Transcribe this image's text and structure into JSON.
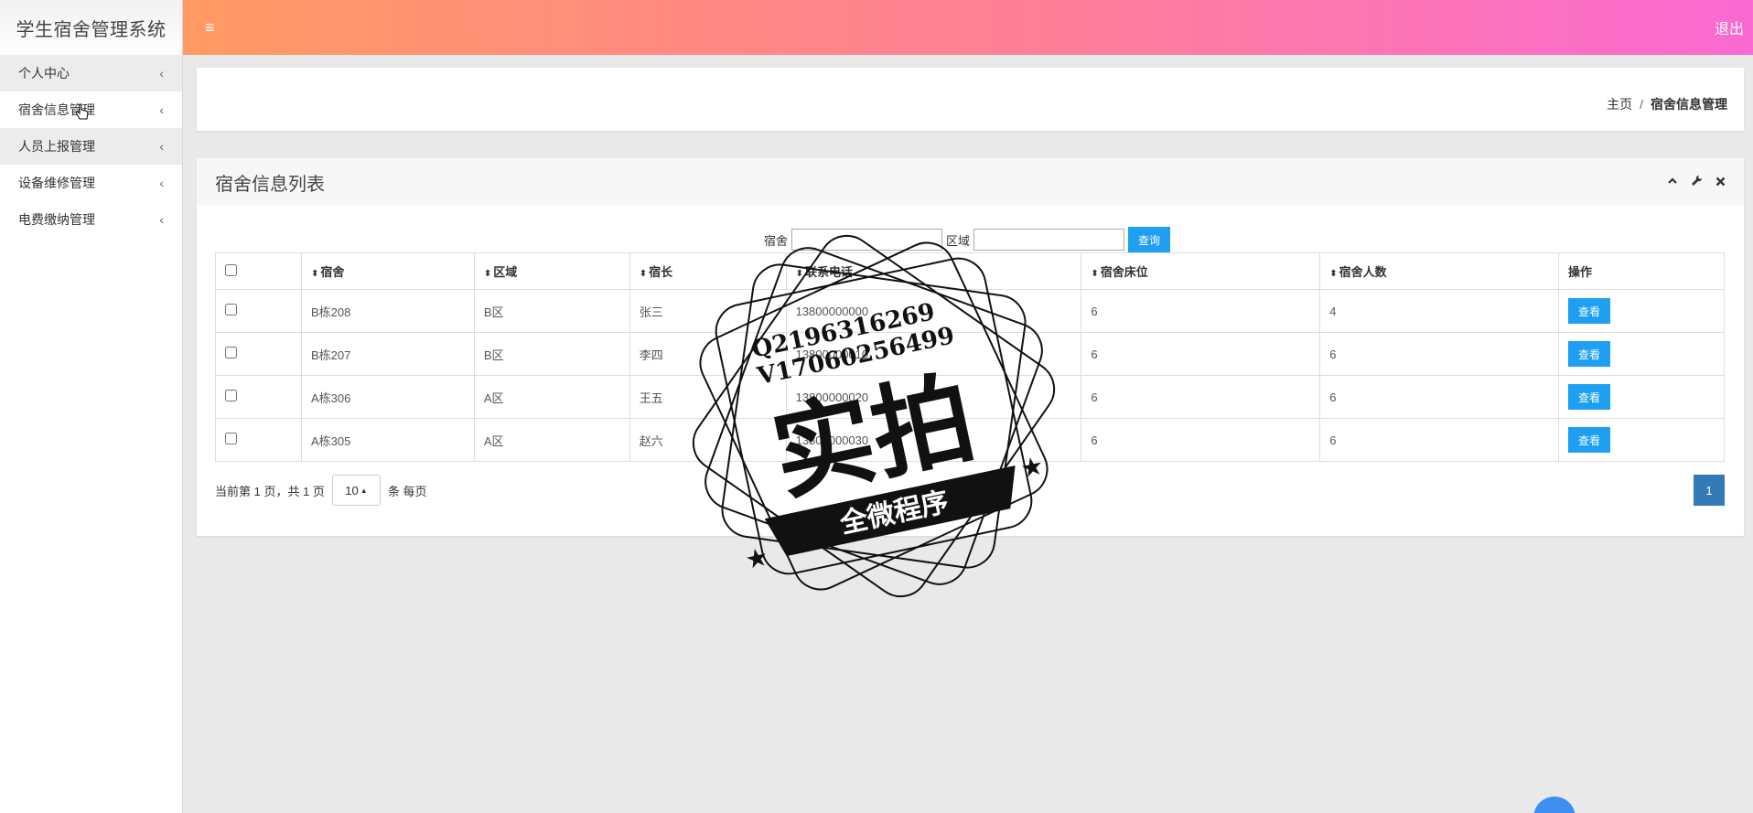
{
  "sidebar": {
    "brand": "学生宿舍管理系统",
    "items": [
      {
        "label": "个人中心"
      },
      {
        "label": "宿舍信息管理"
      },
      {
        "label": "人员上报管理"
      },
      {
        "label": "设备维修管理"
      },
      {
        "label": "电费缴纳管理"
      }
    ]
  },
  "header": {
    "menu_icon": "≡",
    "logout": "退出"
  },
  "breadcrumb": {
    "home": "主页",
    "separator": "/",
    "current": "宿舍信息管理"
  },
  "panel": {
    "title": "宿舍信息列表",
    "tools": [
      "collapse-icon",
      "wrench-icon",
      "close-icon"
    ]
  },
  "search": {
    "dorm_label": "宿舍",
    "dorm_value": "",
    "area_label": "区域",
    "area_value": "",
    "button": "查询"
  },
  "table": {
    "columns": [
      "宿舍",
      "区域",
      "宿长",
      "联系电话",
      "宿舍床位",
      "宿舍人数",
      "操作"
    ],
    "rows": [
      {
        "dorm": "B栋208",
        "area": "B区",
        "leader": "张三",
        "phone": "13800000000",
        "beds": "6",
        "people": "4",
        "action": "查看"
      },
      {
        "dorm": "B栋207",
        "area": "B区",
        "leader": "李四",
        "phone": "13800000010",
        "beds": "6",
        "people": "6",
        "action": "查看"
      },
      {
        "dorm": "A栋306",
        "area": "A区",
        "leader": "王五",
        "phone": "13800000020",
        "beds": "6",
        "people": "6",
        "action": "查看"
      },
      {
        "dorm": "A栋305",
        "area": "A区",
        "leader": "赵六",
        "phone": "13800000030",
        "beds": "6",
        "people": "6",
        "action": "查看"
      }
    ]
  },
  "pager": {
    "info": "当前第 1 页，共 1 页",
    "page_size": "10",
    "per_page": "条 每页",
    "current_page": "1"
  },
  "watermark": {
    "line1": "Q2196316269",
    "line2": "V17060256499",
    "big": "实拍",
    "ribbon": "全微程序"
  },
  "colors": {
    "accent": "#1e9ff2",
    "pager": "#337ab7",
    "header_start": "#ff9a63",
    "header_end": "#f96ad2"
  }
}
